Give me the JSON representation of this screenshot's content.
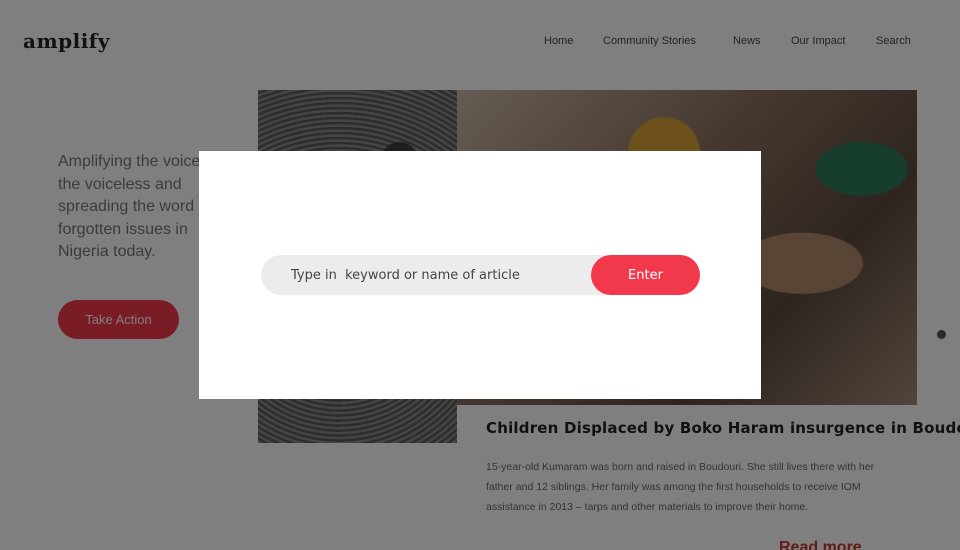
{
  "brand": {
    "logo_text": "amplify"
  },
  "nav": {
    "items": [
      {
        "label": "Home"
      },
      {
        "label": "Community  Stories"
      },
      {
        "label": "News"
      },
      {
        "label": "Our Impact"
      },
      {
        "label": "Search"
      }
    ]
  },
  "hero": {
    "tagline": "Amplifying the voices of the voiceless and spreading the word on forgotten issues in Nigeria today.",
    "cta_label": "Take Action"
  },
  "article": {
    "title": "Children Displaced by Boko Haram insurgence in Boudori",
    "body": "15-year-old Kumaram was born and raised in Boudouri. She still lives there with her father and 12 siblings. Her family was among the first households to receive IOM assistance in 2013 – tarps and other materials to improve their home.",
    "read_more": "Read more"
  },
  "search_modal": {
    "placeholder": "Type in  keyword or name of article",
    "value": "",
    "submit_label": "Enter"
  },
  "colors": {
    "accent": "#f2394b",
    "overlay": "rgba(0,0,0,0.5)"
  }
}
